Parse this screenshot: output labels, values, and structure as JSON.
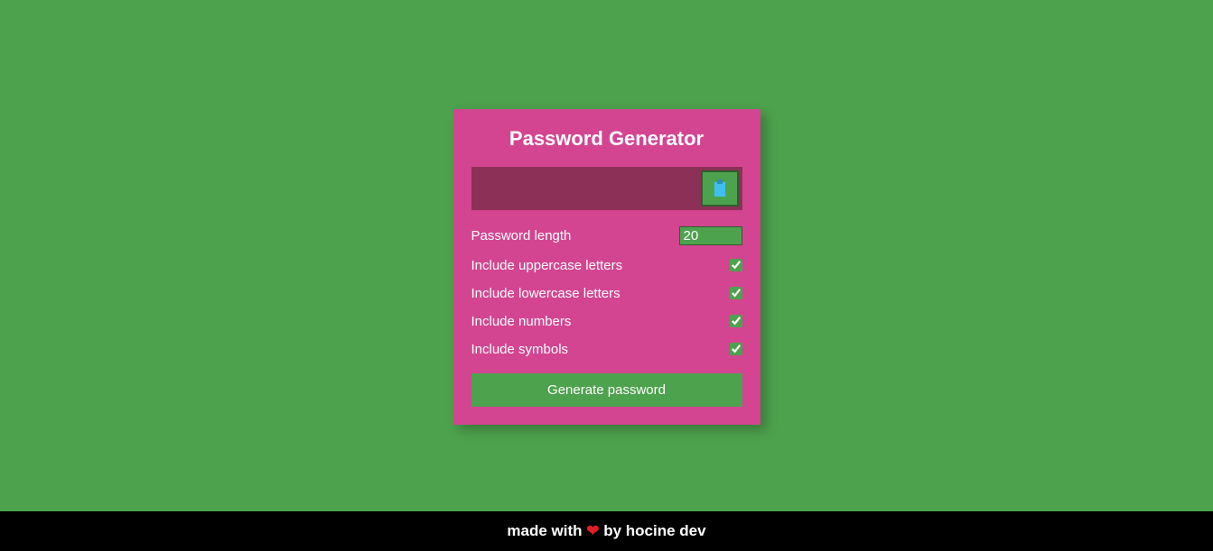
{
  "title": "Password Generator",
  "result": {
    "value": ""
  },
  "settings": {
    "length": {
      "label": "Password length",
      "value": "20"
    },
    "uppercase": {
      "label": "Include uppercase letters",
      "checked": true
    },
    "lowercase": {
      "label": "Include lowercase letters",
      "checked": true
    },
    "numbers": {
      "label": "Include numbers",
      "checked": true
    },
    "symbols": {
      "label": "Include symbols",
      "checked": true
    }
  },
  "generate_label": "Generate password",
  "footer": {
    "prefix": "made with ",
    "heart": "❤",
    "suffix": " by hocine dev"
  }
}
